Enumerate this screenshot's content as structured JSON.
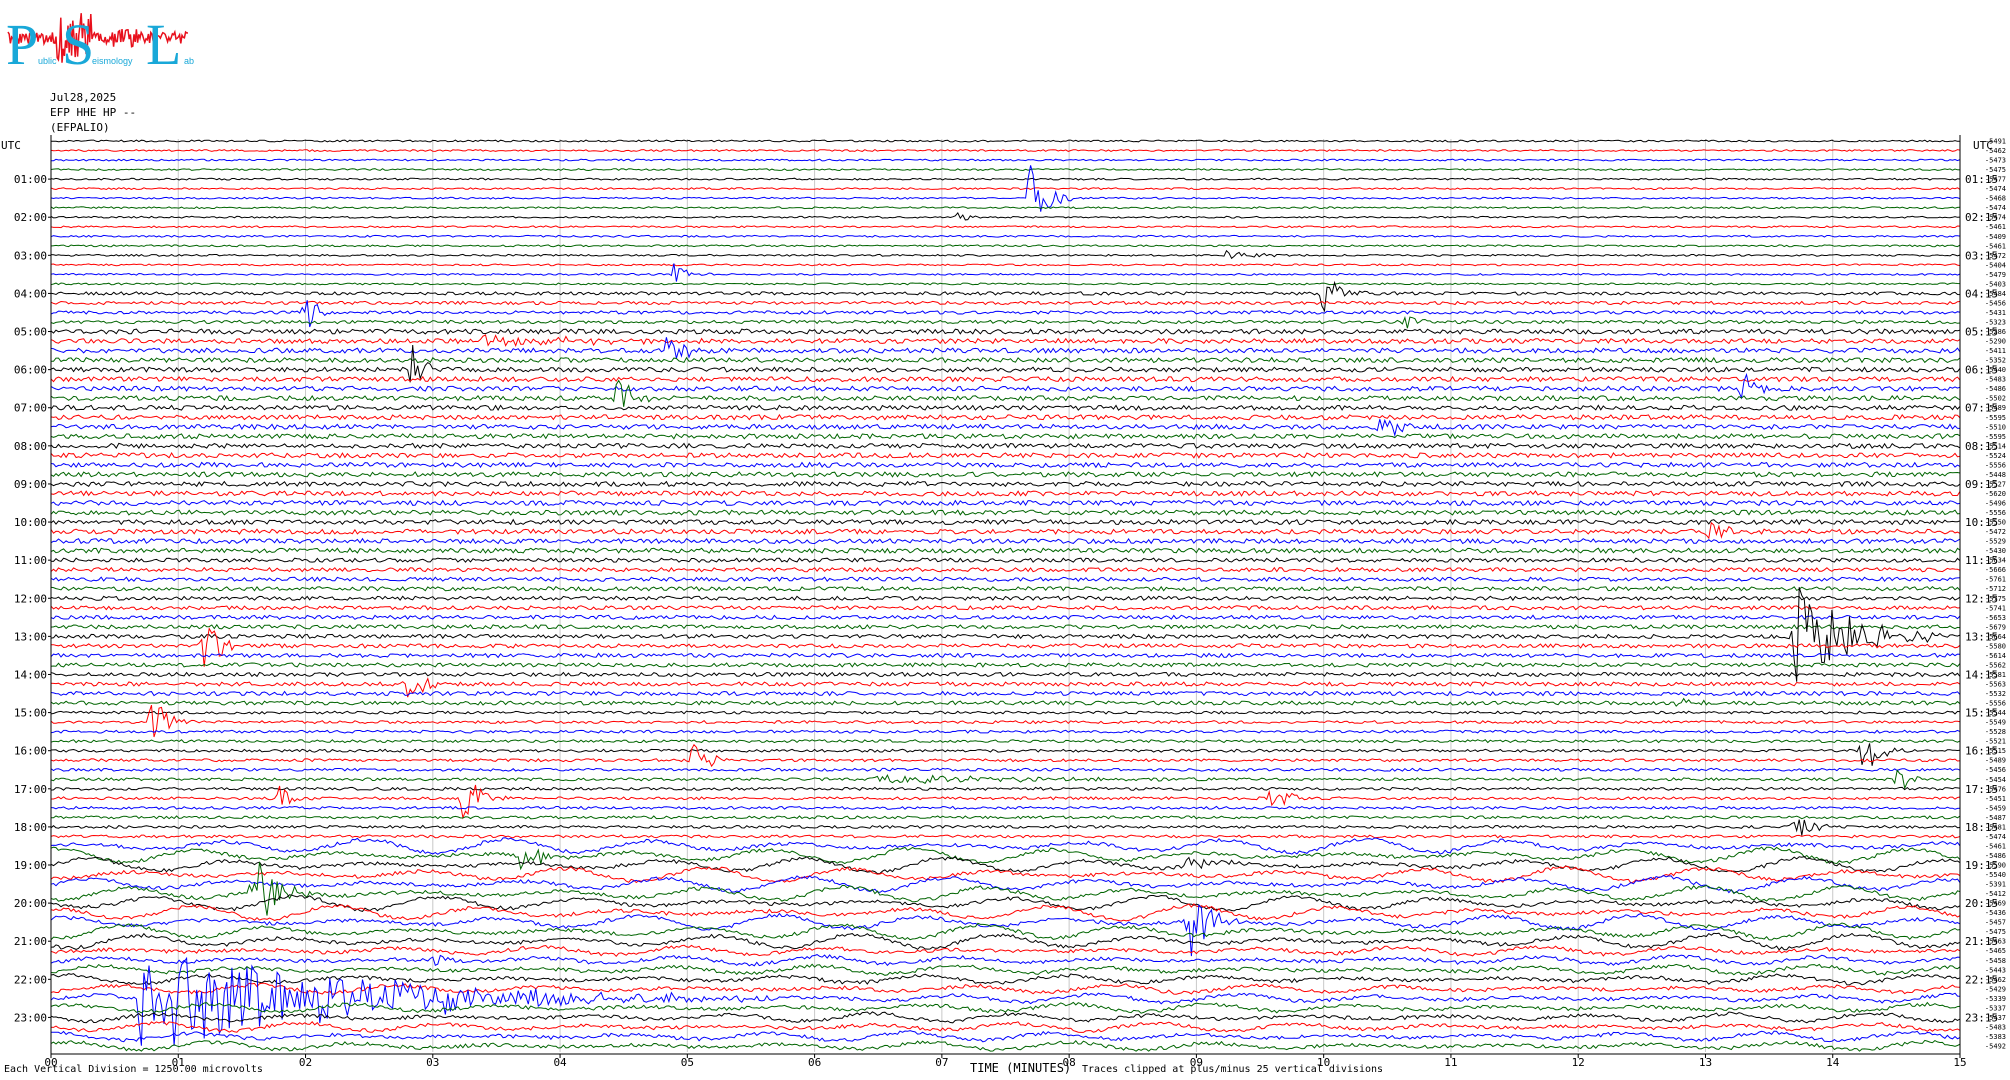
{
  "logo": {
    "letters": [
      "P",
      "S",
      "L"
    ],
    "small_text": [
      "ublic",
      "eismology",
      "ab"
    ],
    "colors": {
      "letters": "#19a8d8",
      "trace": "#e8101c"
    }
  },
  "header": {
    "date": "Jul28,2025",
    "channel": "EFP HHE HP --",
    "station": "(EFPALIO)"
  },
  "footer": {
    "scale_note": "Each Vertical Division = 1250.00 microvolts",
    "xlabel": "TIME (MINUTES)",
    "clip_note": "Traces clipped at plus/minus 25 vertical divisions"
  },
  "chart_data": {
    "type": "line",
    "title": "",
    "xlabel": "TIME (MINUTES)",
    "ylabel": "UTC",
    "left_axis_title": "UTC",
    "right_axis_title": "UTC",
    "x_ticks": [
      "00",
      "01",
      "02",
      "03",
      "04",
      "05",
      "06",
      "07",
      "08",
      "09",
      "10",
      "11",
      "12",
      "13",
      "14",
      "15"
    ],
    "xlim": [
      0,
      15
    ],
    "trace_count": 96,
    "trace_minutes": 15,
    "series_color_cycle": [
      "#000000",
      "#ff0000",
      "#0000ff",
      "#006400"
    ],
    "left_hour_labels": [
      "01:00",
      "02:00",
      "03:00",
      "04:00",
      "05:00",
      "06:00",
      "07:00",
      "08:00",
      "09:00",
      "10:00",
      "11:00",
      "12:00",
      "13:00",
      "14:00",
      "15:00",
      "16:00",
      "17:00",
      "18:00",
      "19:00",
      "20:00",
      "21:00",
      "22:00",
      "23:00"
    ],
    "right_hour_labels": [
      "01:15",
      "02:15",
      "03:15",
      "04:15",
      "05:15",
      "06:15",
      "07:15",
      "08:15",
      "09:15",
      "10:15",
      "11:15",
      "12:15",
      "13:15",
      "14:15",
      "15:15",
      "16:15",
      "17:15",
      "18:15",
      "19:15",
      "20:15",
      "21:15",
      "22:15",
      "23:15"
    ],
    "trace_offsets": [
      "-5491",
      "-5462",
      "-5473",
      "-5475",
      "-5477",
      "-5474",
      "-5468",
      "-5474",
      "-5474",
      "-5461",
      "-5409",
      "-5461",
      "-5472",
      "-5404",
      "-5479",
      "-5403",
      "-5484",
      "-5456",
      "-5431",
      "-5323",
      "-5286",
      "-5290",
      "-5411",
      "-5352",
      "-5440",
      "-5483",
      "-5486",
      "-5502",
      "-5489",
      "-5595",
      "-5510",
      "-5595",
      "-5514",
      "-5524",
      "-5556",
      "-5448",
      "-5527",
      "-5620",
      "-5496",
      "-5556",
      "-5550",
      "-5472",
      "-5529",
      "-5430",
      "-5634",
      "-5666",
      "-5761",
      "-5712",
      "-5775",
      "-5741",
      "-5653",
      "-5679",
      "-5664",
      "-5580",
      "-5614",
      "-5562",
      "-5581",
      "-5563",
      "-5532",
      "-5556",
      "-5544",
      "-5549",
      "-5528",
      "-5521",
      "-5515",
      "-5489",
      "-5456",
      "-5454",
      "-5476",
      "-5451",
      "-5459",
      "-5487",
      "-5481",
      "-5474",
      "-5461",
      "-5486",
      "-5590",
      "-5540",
      "-5391",
      "-5412",
      "-5469",
      "-5436",
      "-5457",
      "-5475",
      "-5463",
      "-5465",
      "-5458",
      "-5443",
      "-5462",
      "-5429",
      "-5339",
      "-5337",
      "-5437",
      "-5483",
      "-5383",
      "-5492"
    ],
    "events": [
      {
        "trace": 6,
        "minute": 7.7,
        "amplitude": 36,
        "duration": 0.35
      },
      {
        "trace": 8,
        "minute": 7.1,
        "amplitude": 6,
        "duration": 0.3
      },
      {
        "trace": 12,
        "minute": 9.25,
        "amplitude": 8,
        "duration": 0.4
      },
      {
        "trace": 14,
        "minute": 4.9,
        "amplitude": 12,
        "duration": 0.3
      },
      {
        "trace": 16,
        "minute": 10.0,
        "amplitude": 26,
        "duration": 0.35
      },
      {
        "trace": 18,
        "minute": 2.0,
        "amplitude": 22,
        "duration": 0.25
      },
      {
        "trace": 19,
        "minute": 10.65,
        "amplitude": 14,
        "duration": 0.2
      },
      {
        "trace": 21,
        "minute": 3.4,
        "amplitude": 7,
        "duration": 2.2
      },
      {
        "trace": 22,
        "minute": 4.85,
        "amplitude": 22,
        "duration": 0.35
      },
      {
        "trace": 24,
        "minute": 2.85,
        "amplitude": 28,
        "duration": 0.3
      },
      {
        "trace": 26,
        "minute": 13.3,
        "amplitude": 18,
        "duration": 0.25
      },
      {
        "trace": 27,
        "minute": 4.45,
        "amplitude": 30,
        "duration": 0.35
      },
      {
        "trace": 30,
        "minute": 10.45,
        "amplitude": 18,
        "duration": 0.3
      },
      {
        "trace": 41,
        "minute": 13.0,
        "amplitude": 10,
        "duration": 0.6
      },
      {
        "trace": 52,
        "minute": 13.7,
        "amplitude": 55,
        "duration": 1.2
      },
      {
        "trace": 53,
        "minute": 1.2,
        "amplitude": 30,
        "duration": 0.35
      },
      {
        "trace": 57,
        "minute": 2.8,
        "amplitude": 28,
        "duration": 0.3
      },
      {
        "trace": 59,
        "minute": 12.8,
        "amplitude": 8,
        "duration": 0.3
      },
      {
        "trace": 61,
        "minute": 0.8,
        "amplitude": 30,
        "duration": 0.35
      },
      {
        "trace": 64,
        "minute": 14.25,
        "amplitude": 26,
        "duration": 0.35
      },
      {
        "trace": 65,
        "minute": 5.05,
        "amplitude": 22,
        "duration": 0.3
      },
      {
        "trace": 67,
        "minute": 14.5,
        "amplitude": 24,
        "duration": 0.25
      },
      {
        "trace": 67,
        "minute": 6.5,
        "amplitude": 5,
        "duration": 3.0
      },
      {
        "trace": 69,
        "minute": 1.8,
        "amplitude": 14,
        "duration": 0.3
      },
      {
        "trace": 69,
        "minute": 3.25,
        "amplitude": 30,
        "duration": 0.35
      },
      {
        "trace": 69,
        "minute": 9.6,
        "amplitude": 26,
        "duration": 0.3
      },
      {
        "trace": 72,
        "minute": 13.7,
        "amplitude": 18,
        "duration": 0.3
      },
      {
        "trace": 75,
        "minute": 3.7,
        "amplitude": 18,
        "duration": 0.4
      },
      {
        "trace": 76,
        "minute": 8.9,
        "amplitude": 10,
        "duration": 0.6
      },
      {
        "trace": 79,
        "minute": 1.6,
        "amplitude": 50,
        "duration": 0.45
      },
      {
        "trace": 82,
        "minute": 8.95,
        "amplitude": 40,
        "duration": 0.4
      },
      {
        "trace": 86,
        "minute": 3.0,
        "amplitude": 6,
        "duration": 0.5
      },
      {
        "trace": 90,
        "minute": 0.7,
        "amplitude": 55,
        "duration": 5.0
      }
    ]
  }
}
